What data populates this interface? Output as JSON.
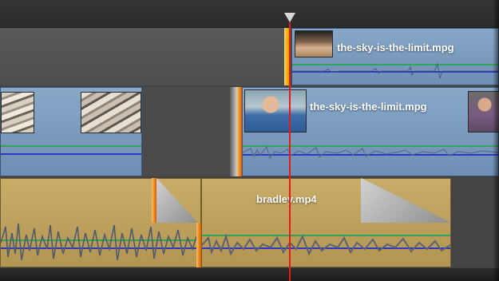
{
  "timeline": {
    "track1_clip_title": "the-sky-is-the-limit.mpg",
    "track2_clip_title": "the-sky-is-the-limit.mpg",
    "track3_clip_title": "bradley.mp4"
  },
  "colors": {
    "video_clip_blue": "#7f9fc0",
    "audio_clip_gold": "#c6a866",
    "playhead_red": "#e21b1b",
    "audio_level_green": "#2fa45a",
    "audio_level_blue": "#3037c8",
    "trim_orange": "#ef8d1f"
  },
  "icons": {
    "playhead": "playhead-triangle-icon"
  }
}
